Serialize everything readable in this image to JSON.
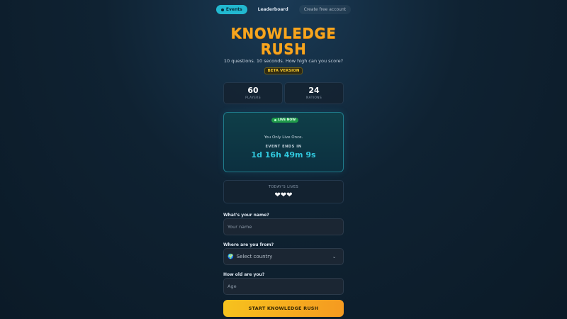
{
  "nav": {
    "events": "Events",
    "leaderboard": "Leaderboard",
    "create_account": "Create free account"
  },
  "header": {
    "title_line1": "KNOWLEDGE",
    "title_line2": "RUSH",
    "subtitle": "10 questions. 10 seconds. How high can you score?",
    "badge": "BETA VERSION"
  },
  "stats": [
    {
      "value": "60",
      "label": "PLAYERS"
    },
    {
      "value": "24",
      "label": "NATIONS"
    }
  ],
  "event": {
    "live_label": "LIVE NOW",
    "tagline": "You Only Live Once.",
    "ends_label": "EVENT ENDS IN",
    "timer": "1d 16h 49m 9s"
  },
  "lives": {
    "label": "TODAY'S LIVES",
    "hearts": "❤❤❤",
    "count": 3
  },
  "form": {
    "name_label": "What's your name?",
    "name_placeholder": "Your name",
    "country_label": "Where are you from?",
    "country_value": "Select country",
    "age_label": "How old are you?",
    "age_placeholder": "Age",
    "submit": "START KNOWLEDGE RUSH"
  },
  "colors": {
    "accent": "#22b8d0",
    "title": "#f7a51e",
    "timer": "#31c8dd",
    "cta_start": "#f6c21e",
    "cta_end": "#f59a20"
  }
}
